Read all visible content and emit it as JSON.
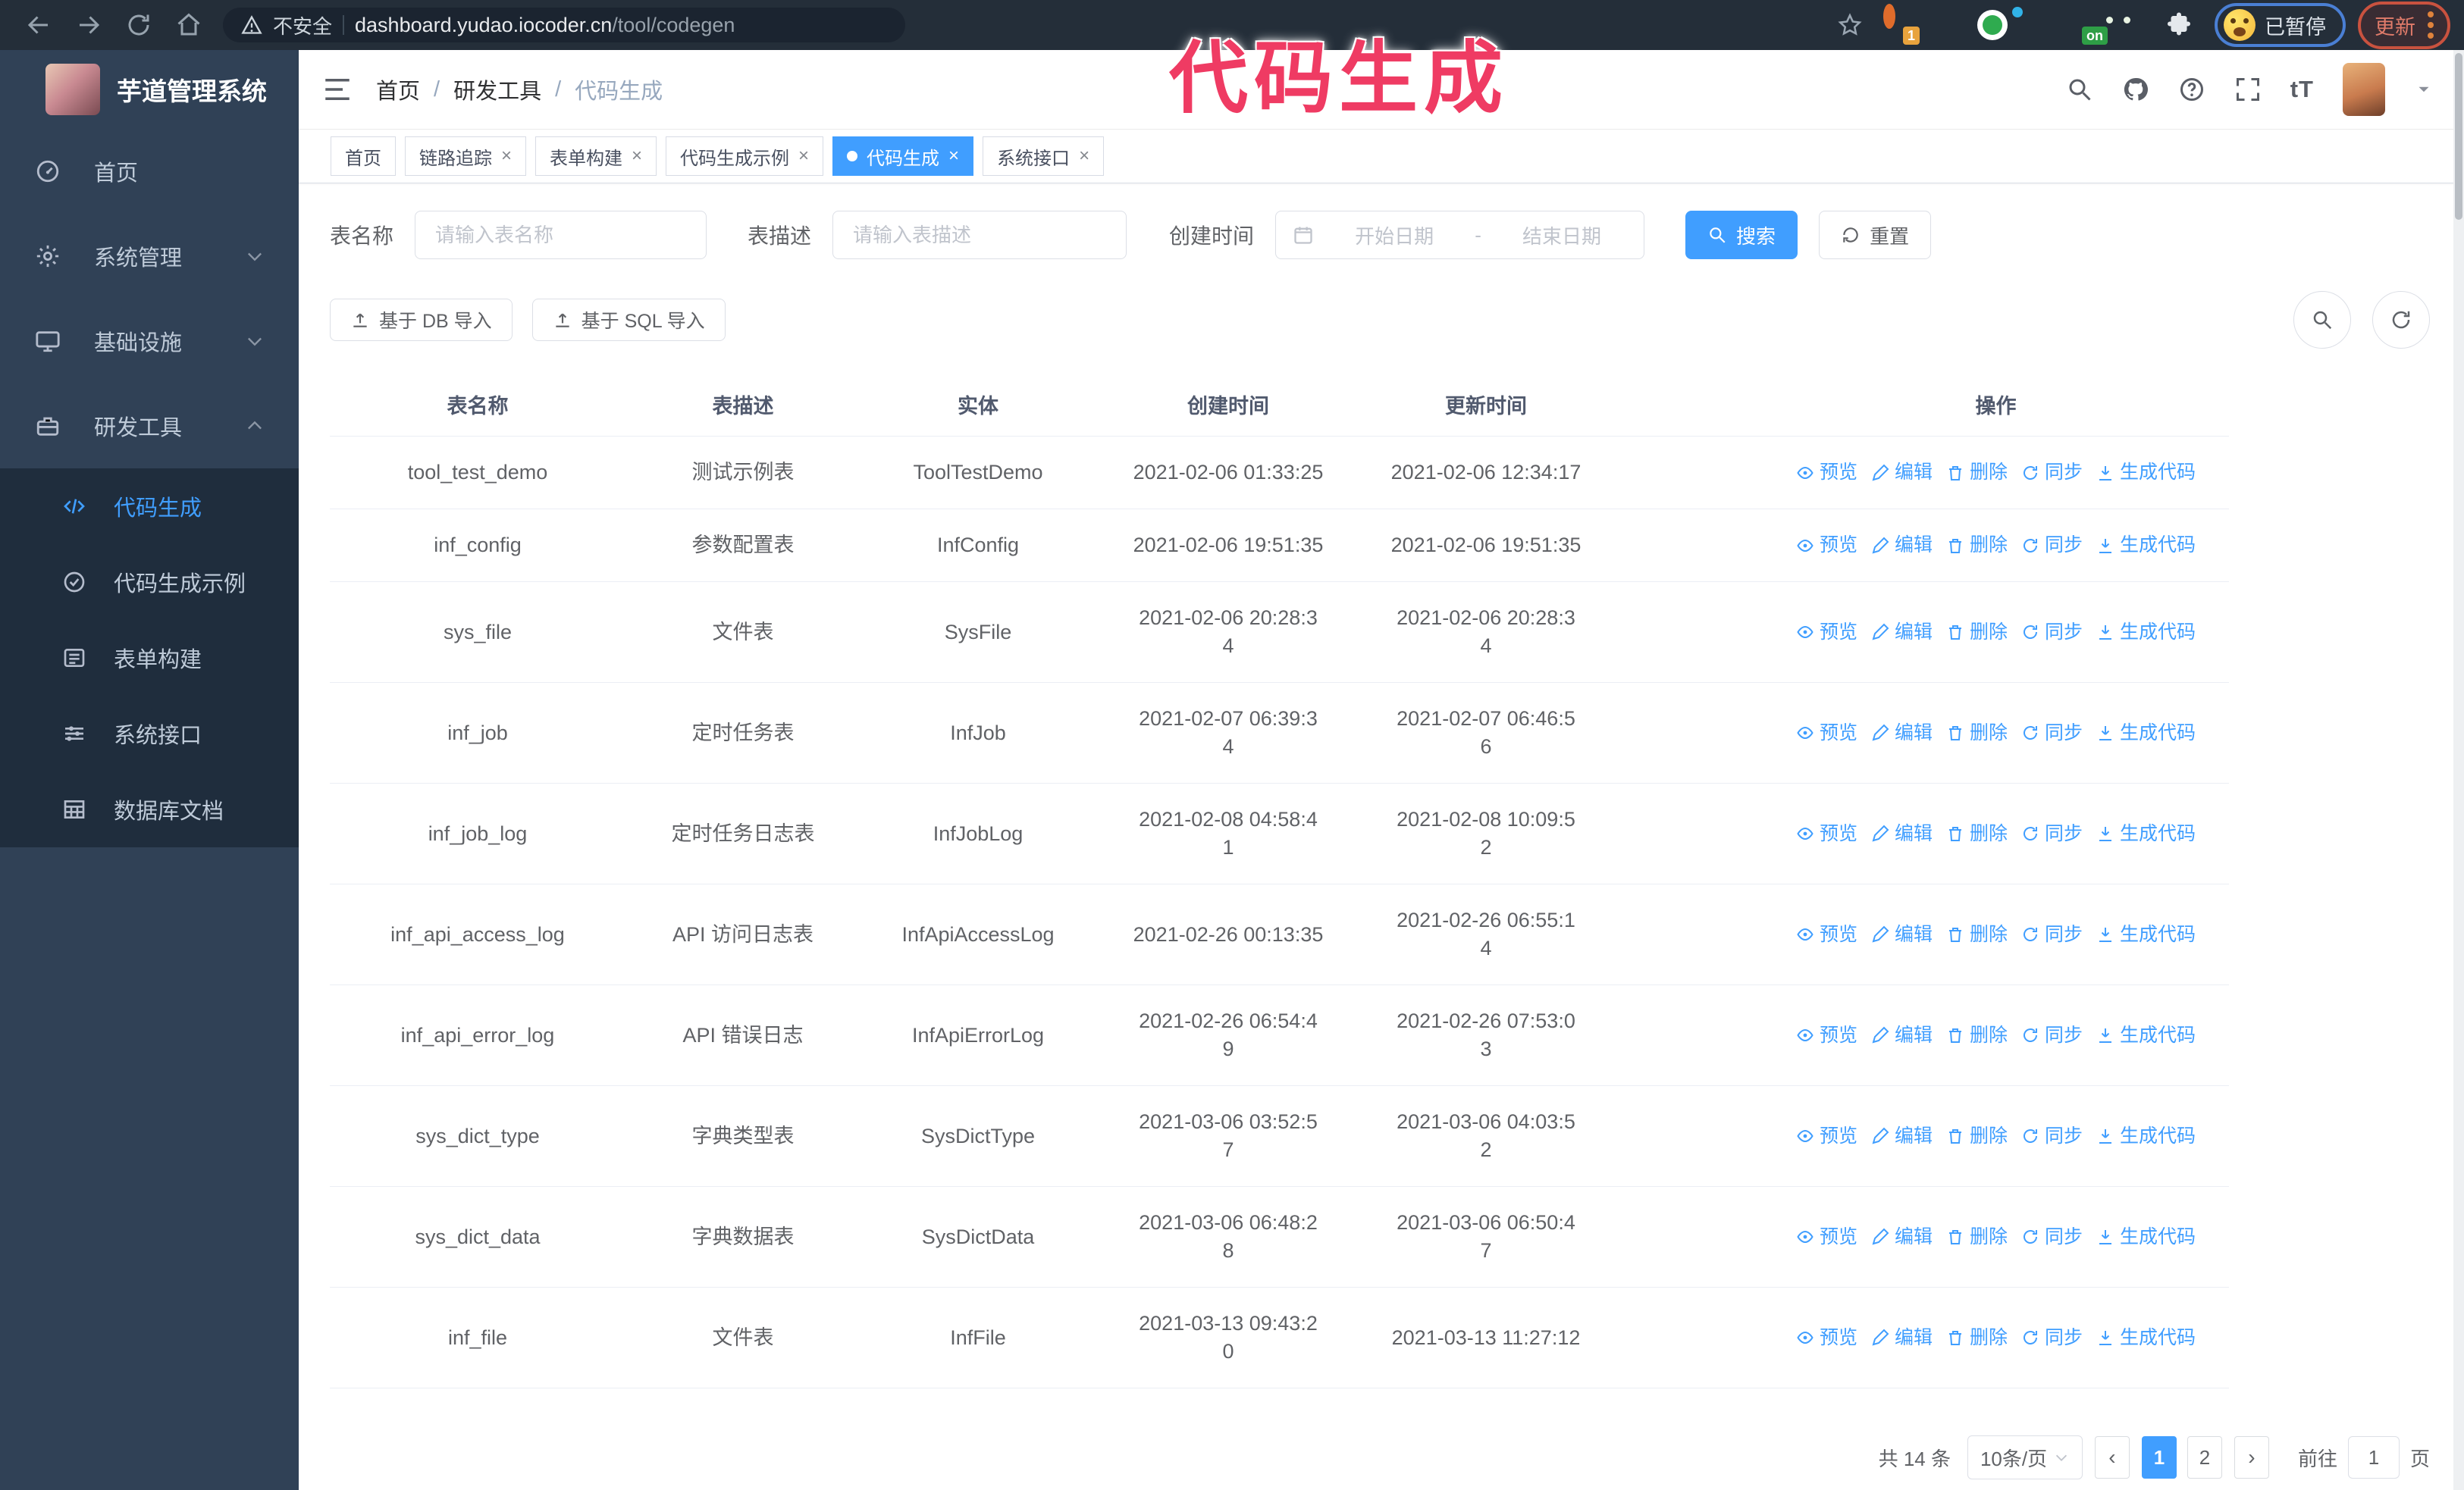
{
  "browser": {
    "security_label": "不安全",
    "url_host": "dashboard.yudao.iocoder.cn",
    "url_path": "/tool/codegen",
    "extension_badge_1": "1",
    "extension_badge_on": "on",
    "paused_badge": "已暂停",
    "update_button": "更新"
  },
  "annotation": {
    "text": "代码生成",
    "color": "#ef3b63"
  },
  "sidebar": {
    "title": "芋道管理系统",
    "menu": [
      {
        "icon": "gauge",
        "label": "首页"
      },
      {
        "icon": "gear",
        "label": "系统管理",
        "chevron": "down"
      },
      {
        "icon": "monitor",
        "label": "基础设施",
        "chevron": "down"
      },
      {
        "icon": "toolbox",
        "label": "研发工具",
        "chevron": "up",
        "expanded": true
      }
    ],
    "submenu": [
      {
        "icon": "code",
        "label": "代码生成",
        "active": true
      },
      {
        "icon": "badge",
        "label": "代码生成示例"
      },
      {
        "icon": "form",
        "label": "表单构建"
      },
      {
        "icon": "sliders",
        "label": "系统接口"
      },
      {
        "icon": "grid",
        "label": "数据库文档"
      }
    ]
  },
  "header": {
    "breadcrumb": [
      "首页",
      "研发工具",
      "代码生成"
    ],
    "text_size_icon": "tT"
  },
  "tabs": [
    {
      "label": "首页",
      "closable": false,
      "active": false
    },
    {
      "label": "链路追踪",
      "closable": true,
      "active": false
    },
    {
      "label": "表单构建",
      "closable": true,
      "active": false
    },
    {
      "label": "代码生成示例",
      "closable": true,
      "active": false
    },
    {
      "label": "代码生成",
      "closable": true,
      "active": true
    },
    {
      "label": "系统接口",
      "closable": true,
      "active": false
    }
  ],
  "filters": {
    "name_label": "表名称",
    "name_placeholder": "请输入表名称",
    "desc_label": "表描述",
    "desc_placeholder": "请输入表描述",
    "time_label": "创建时间",
    "start_placeholder": "开始日期",
    "range_separator": "-",
    "end_placeholder": "结束日期",
    "search_label": "搜索",
    "reset_label": "重置"
  },
  "toolbar": {
    "import_db_label": "基于 DB 导入",
    "import_sql_label": "基于 SQL 导入"
  },
  "table": {
    "columns": [
      "表名称",
      "表描述",
      "实体",
      "创建时间",
      "更新时间",
      "操作"
    ],
    "actions": [
      "预览",
      "编辑",
      "删除",
      "同步",
      "生成代码"
    ],
    "rows": [
      {
        "name": "tool_test_demo",
        "desc": "测试示例表",
        "entity": "ToolTestDemo",
        "created": [
          "2021-02-06 01:33:25"
        ],
        "updated": [
          "2021-02-06 12:34:17"
        ]
      },
      {
        "name": "inf_config",
        "desc": "参数配置表",
        "entity": "InfConfig",
        "created": [
          "2021-02-06 19:51:35"
        ],
        "updated": [
          "2021-02-06 19:51:35"
        ]
      },
      {
        "name": "sys_file",
        "desc": "文件表",
        "entity": "SysFile",
        "created": [
          "2021-02-06 20:28:3",
          "4"
        ],
        "updated": [
          "2021-02-06 20:28:3",
          "4"
        ]
      },
      {
        "name": "inf_job",
        "desc": "定时任务表",
        "entity": "InfJob",
        "created": [
          "2021-02-07 06:39:3",
          "4"
        ],
        "updated": [
          "2021-02-07 06:46:5",
          "6"
        ]
      },
      {
        "name": "inf_job_log",
        "desc": "定时任务日志表",
        "entity": "InfJobLog",
        "created": [
          "2021-02-08 04:58:4",
          "1"
        ],
        "updated": [
          "2021-02-08 10:09:5",
          "2"
        ]
      },
      {
        "name": "inf_api_access_log",
        "desc": "API 访问日志表",
        "entity": "InfApiAccessLog",
        "created": [
          "2021-02-26 00:13:35"
        ],
        "updated": [
          "2021-02-26 06:55:1",
          "4"
        ]
      },
      {
        "name": "inf_api_error_log",
        "desc": "API 错误日志",
        "entity": "InfApiErrorLog",
        "created": [
          "2021-02-26 06:54:4",
          "9"
        ],
        "updated": [
          "2021-02-26 07:53:0",
          "3"
        ]
      },
      {
        "name": "sys_dict_type",
        "desc": "字典类型表",
        "entity": "SysDictType",
        "created": [
          "2021-03-06 03:52:5",
          "7"
        ],
        "updated": [
          "2021-03-06 04:03:5",
          "2"
        ]
      },
      {
        "name": "sys_dict_data",
        "desc": "字典数据表",
        "entity": "SysDictData",
        "created": [
          "2021-03-06 06:48:2",
          "8"
        ],
        "updated": [
          "2021-03-06 06:50:4",
          "7"
        ]
      },
      {
        "name": "inf_file",
        "desc": "文件表",
        "entity": "InfFile",
        "created": [
          "2021-03-13 09:43:2",
          "0"
        ],
        "updated": [
          "2021-03-13 11:27:12"
        ]
      }
    ]
  },
  "pagination": {
    "total_label": "共 14 条",
    "page_size": "10条/页",
    "pages": [
      "1",
      "2"
    ],
    "active_page": "1",
    "goto_label": "前往",
    "goto_value": "1",
    "page_suffix": "页"
  },
  "colors": {
    "primary": "#409eff",
    "sidebar_bg": "#304156",
    "submenu_bg": "#1f2d3d",
    "annotation": "#ef3b63",
    "browser_bar": "#242e39"
  }
}
